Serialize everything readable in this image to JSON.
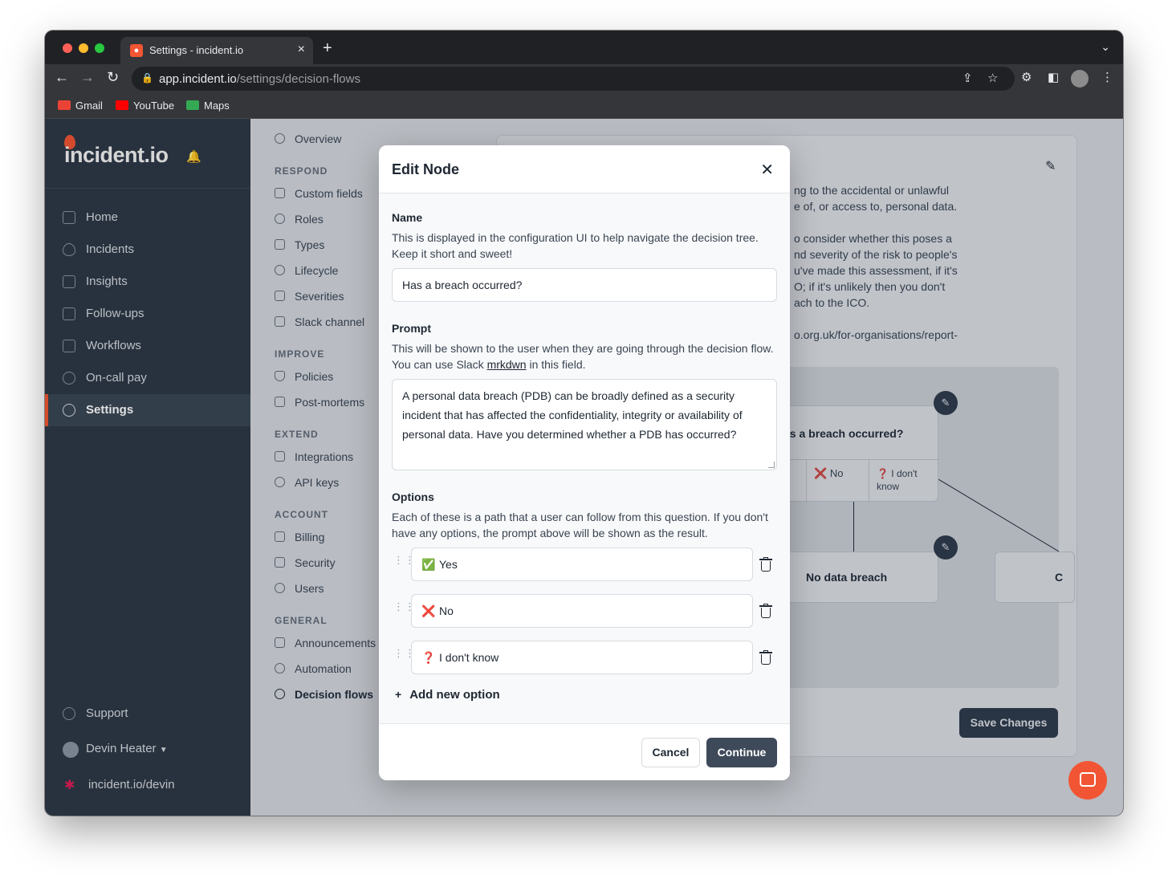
{
  "browser": {
    "tab_title": "Settings - incident.io",
    "url_host": "app.incident.io",
    "url_path": "/settings/decision-flows",
    "bookmarks": [
      "Gmail",
      "YouTube",
      "Maps"
    ]
  },
  "sidebar": {
    "logo": "incident.io",
    "items": [
      {
        "label": "Home",
        "icon": "home-icon"
      },
      {
        "label": "Incidents",
        "icon": "flame-icon"
      },
      {
        "label": "Insights",
        "icon": "chart-icon"
      },
      {
        "label": "Follow-ups",
        "icon": "checklist-icon"
      },
      {
        "label": "Workflows",
        "icon": "workflow-icon"
      },
      {
        "label": "On-call pay",
        "icon": "phone-icon"
      },
      {
        "label": "Settings",
        "icon": "gear-icon",
        "active": true
      }
    ],
    "support": "Support",
    "user": "Devin Heater",
    "workspace": "incident.io/devin"
  },
  "subnav": {
    "overview": "Overview",
    "sections": [
      {
        "heading": "RESPOND",
        "items": [
          "Custom fields",
          "Roles",
          "Types",
          "Lifecycle",
          "Severities",
          "Slack channel"
        ]
      },
      {
        "heading": "IMPROVE",
        "items": [
          "Policies",
          "Post-mortems"
        ]
      },
      {
        "heading": "EXTEND",
        "items": [
          "Integrations",
          "API keys"
        ]
      },
      {
        "heading": "ACCOUNT",
        "items": [
          "Billing",
          "Security",
          "Users"
        ]
      },
      {
        "heading": "GENERAL",
        "items": [
          "Announcements",
          "Automation",
          "Decision flows"
        ]
      }
    ],
    "active": "Decision flows"
  },
  "background_content": {
    "lines": [
      "ng to the accidental or unlawful",
      "e of, or access to, personal data.",
      "o consider whether this poses a",
      "nd severity of the risk to people's",
      "u've made this assessment, if it's",
      "O; if it's unlikely then you don't",
      "ach to the ICO.",
      "o.org.uk/for-organisations/report-"
    ],
    "tree_question": "as a breach occurred?",
    "tree_opt_no": "No",
    "tree_opt_dont_know_1": "I don't",
    "tree_opt_dont_know_2": "know",
    "tree_child": "No data breach",
    "tree_child_2": "C",
    "save_button": "Save Changes"
  },
  "modal": {
    "title": "Edit Node",
    "name_label": "Name",
    "name_help": "This is displayed in the configuration UI to help navigate the decision tree. Keep it short and sweet!",
    "name_value": "Has a breach occurred?",
    "prompt_label": "Prompt",
    "prompt_help_pre": "This will be shown to the user when they are going through the decision flow. You can use Slack ",
    "prompt_help_link": "mrkdwn",
    "prompt_help_post": " in this field.",
    "prompt_value": "A personal data breach (PDB) can be broadly defined as a security incident that has affected the confidentiality, integrity or availability of personal data. Have you determined whether a PDB has occurred?",
    "options_label": "Options",
    "options_help": "Each of these is a path that a user can follow from this question. If you don't have any options, the prompt above will be shown as the result.",
    "options": [
      {
        "emoji": "✅",
        "label": "Yes",
        "color": "#2fb344"
      },
      {
        "emoji": "❌",
        "label": "No",
        "color": "#e0245e"
      },
      {
        "emoji": "❓",
        "label": "I don't know",
        "color": "#e0245e"
      }
    ],
    "add_option": "Add new option",
    "cancel": "Cancel",
    "continue": "Continue"
  },
  "colors": {
    "sidebar": "#2e3a48",
    "accent": "#f25533",
    "primary_button": "#3e4a5a"
  }
}
